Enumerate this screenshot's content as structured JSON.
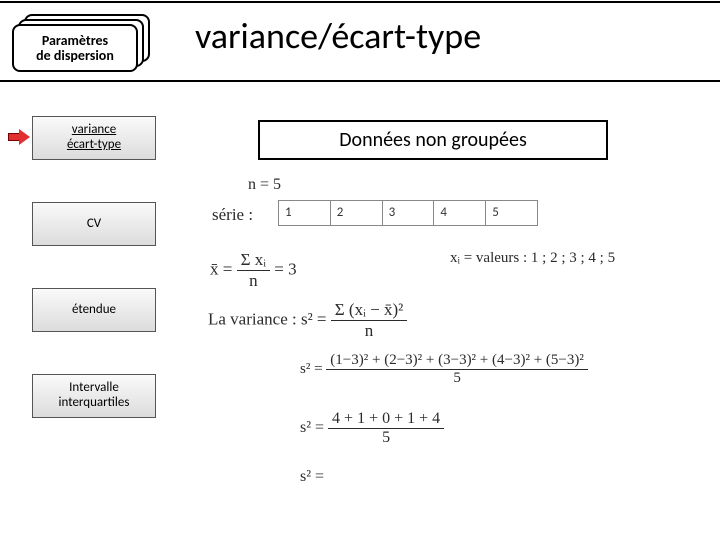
{
  "header": {
    "stack_label_line1": "Paramètres",
    "stack_label_line2": "de dispersion",
    "title": "variance/écart-type"
  },
  "subheader": {
    "label": "Données non groupées"
  },
  "sidebar": {
    "items": [
      {
        "label_line1": "variance",
        "label_line2": "écart-type",
        "active": true
      },
      {
        "label_line1": "CV",
        "label_line2": "",
        "active": false
      },
      {
        "label_line1": "étendue",
        "label_line2": "",
        "active": false
      },
      {
        "label_line1": "Intervalle",
        "label_line2": "interquartiles",
        "active": false
      }
    ]
  },
  "notes": {
    "n_expr": "n = 5",
    "serie_label": "série :",
    "series_values": [
      "1",
      "2",
      "3",
      "4",
      "5"
    ],
    "xbar": "x̄ =",
    "xbar_frac_num": "Σ xᵢ",
    "xbar_frac_den": "n",
    "xbar_val": "= 3",
    "xi_list": "xᵢ = valeurs : 1 ; 2 ; 3 ; 4 ; 5",
    "variance_label": "La variance : s² =",
    "variance_def_num": "Σ (xᵢ − x̄)²",
    "variance_def_den": "n",
    "s2a": "s² =",
    "s2a_num": "(1−3)² + (2−3)² + (3−3)² + (4−3)² + (5−3)²",
    "s2a_den": "5",
    "s2b": "s² =",
    "s2b_num": "4 + 1 + 0 + 1 + 4",
    "s2b_den": "5",
    "s2c": "s² ="
  }
}
